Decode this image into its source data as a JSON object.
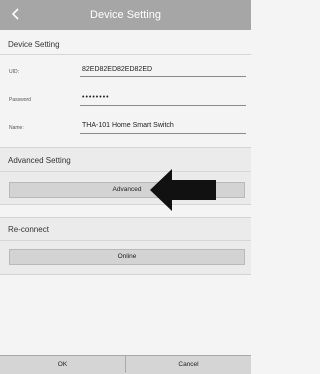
{
  "header": {
    "title": "Device Setting",
    "back_icon": "back-chevron-icon"
  },
  "device_section": {
    "title": "Device Setting",
    "uid_label": "UID:",
    "uid_value": "82ED82ED82ED82ED",
    "password_label": "Password",
    "password_value": "••••••••",
    "name_label": "Name:",
    "name_value": "THA-101 Home Smart Switch"
  },
  "advanced_section": {
    "title": "Advanced Setting",
    "button_label": "Advanced"
  },
  "reconnect_section": {
    "title": "Re-connect",
    "button_label": "Online"
  },
  "footer": {
    "ok_label": "OK",
    "cancel_label": "Cancel"
  },
  "colors": {
    "titlebar": "#a6a6a6",
    "button": "#d3d3d3",
    "arrow": "#111111"
  }
}
